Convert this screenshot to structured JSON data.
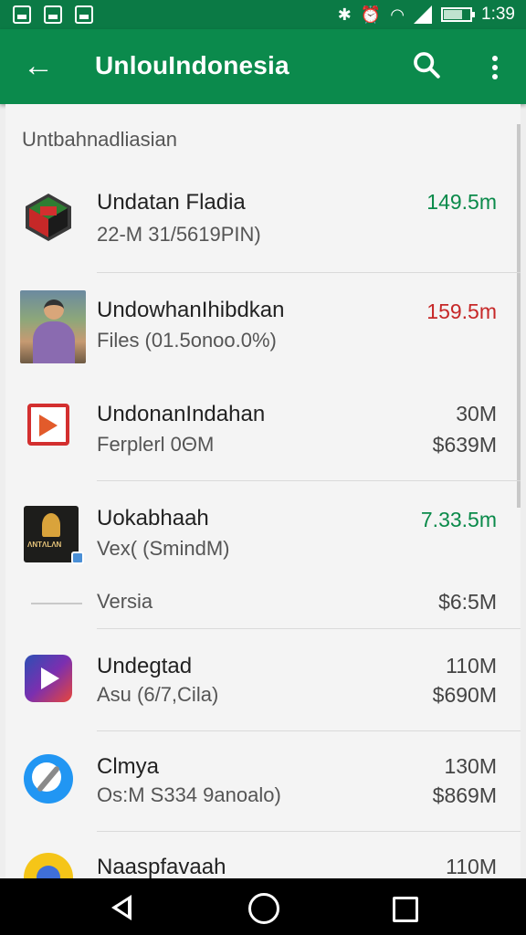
{
  "status_bar": {
    "time": "1:39",
    "icons": [
      "image-icon",
      "sim-icon",
      "photo-icon",
      "bluetooth-icon",
      "alarm-icon",
      "wifi-icon",
      "signal-icon",
      "battery-icon"
    ],
    "battery_level": 0.7
  },
  "app_bar": {
    "back_icon": "arrow-left-icon",
    "title": "UnlouIndonesia",
    "search_icon": "search-icon",
    "more_icon": "more-vert-icon",
    "background": "#0b8a4c"
  },
  "list": {
    "section_header": "Untbahnadliasian",
    "items": [
      {
        "name": "Undatan Fladia",
        "sub": "22-M 31/5619PIN)",
        "val1": "149.5m",
        "val1_color": "#0a8a4a",
        "val2": "",
        "icon": "box-app-icon"
      },
      {
        "name": "UndowhanIhibdkan",
        "sub": "Files (01.5onoo.0%)",
        "val1": "159.5m",
        "val1_color": "#c62828",
        "val2": "",
        "icon": "photo-avatar-icon"
      },
      {
        "name": "UndonanIndahan",
        "sub": "Ferplerl 0ΘM",
        "val1": "30M",
        "val1_color": "#444444",
        "val2": "$639M",
        "icon": "red-play-icon"
      },
      {
        "name": "Uokabhaah",
        "sub": "Vex( (SmindM)",
        "val1": "7.33.5m",
        "val1_color": "#0a8a4a",
        "val2": "",
        "icon": "dark-leaf-icon"
      },
      {
        "name": "",
        "sub": "Versia",
        "val1": "",
        "val1_color": "#444444",
        "val2": "$6:5M",
        "icon": ""
      },
      {
        "name": "Undegtad",
        "sub": "Asu (6/7,Cila)",
        "val1": "110M",
        "val1_color": "#444444",
        "val2": "$690M",
        "icon": "gradient-play-icon"
      },
      {
        "name": "Clmya",
        "sub": "Os:M S334 9anoalo)",
        "val1": "130M",
        "val1_color": "#444444",
        "val2": "$869M",
        "icon": "compass-icon"
      },
      {
        "name": "Naaspfavaah",
        "sub": "",
        "val1": "110M",
        "val1_color": "#444444",
        "val2": "",
        "icon": "yellow-circle-icon"
      }
    ]
  },
  "nav_bar": {
    "back_icon": "nav-back-icon",
    "home_icon": "nav-home-icon",
    "recent_icon": "nav-recent-icon"
  }
}
